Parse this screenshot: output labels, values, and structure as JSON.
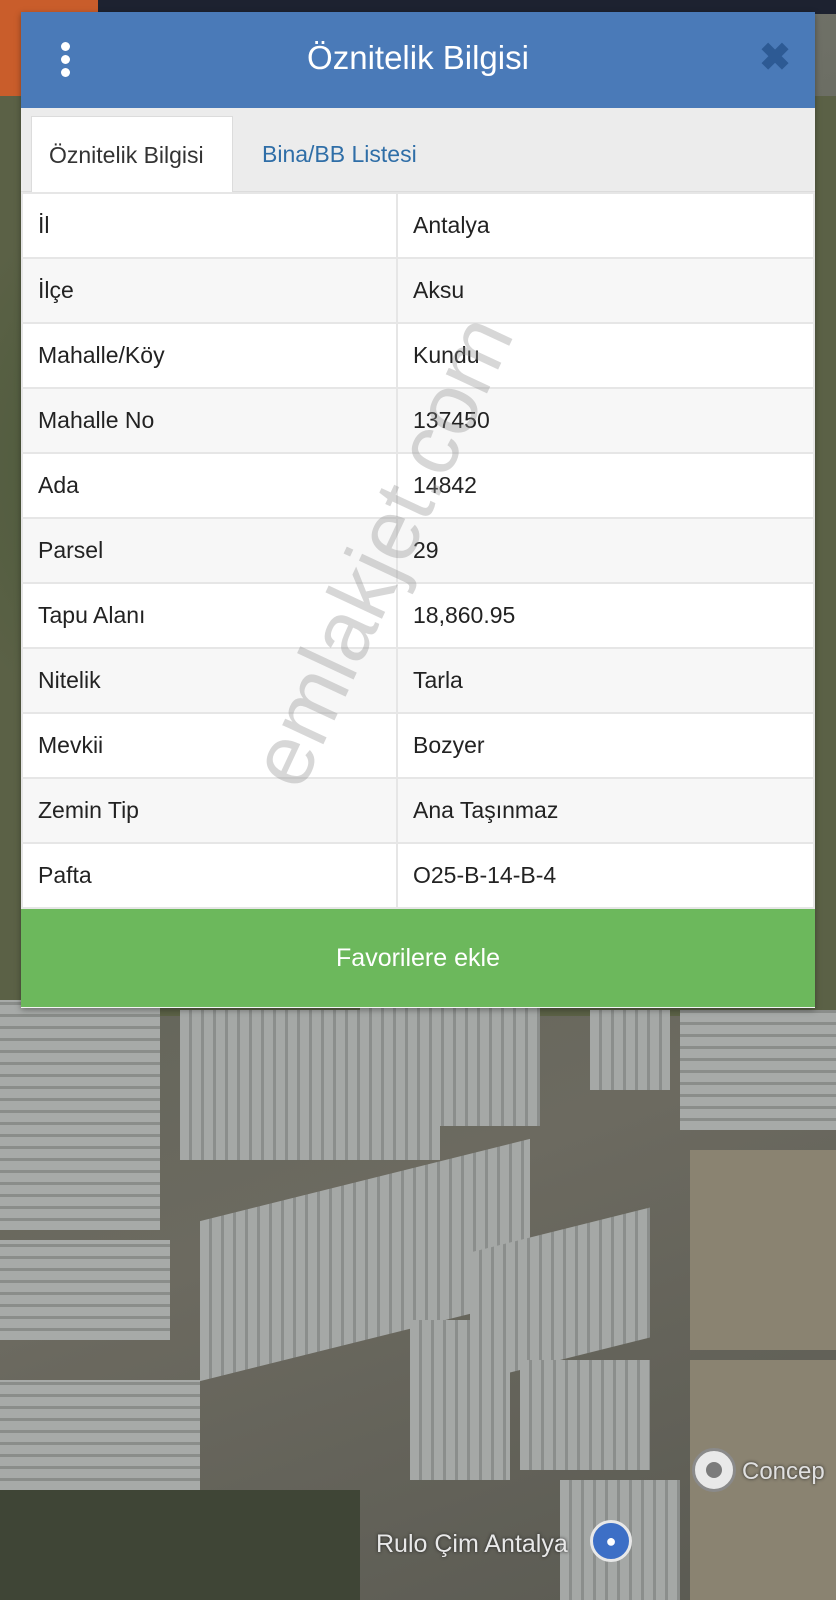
{
  "dialog": {
    "title": "Öznitelik Bilgisi",
    "menu_icon": "vertical-dots-icon",
    "close_icon": "close-icon"
  },
  "tabs": [
    {
      "label": "Öznitelik Bilgisi",
      "active": true
    },
    {
      "label": "Bina/BB Listesi",
      "active": false
    }
  ],
  "attributes": [
    {
      "key": "İl",
      "value": "Antalya"
    },
    {
      "key": "İlçe",
      "value": "Aksu"
    },
    {
      "key": "Mahalle/Köy",
      "value": "Kundu"
    },
    {
      "key": "Mahalle No",
      "value": "137450"
    },
    {
      "key": "Ada",
      "value": "14842"
    },
    {
      "key": "Parsel",
      "value": "29"
    },
    {
      "key": "Tapu Alanı",
      "value": "18,860.95"
    },
    {
      "key": "Nitelik",
      "value": "Tarla"
    },
    {
      "key": "Mevkii",
      "value": "Bozyer"
    },
    {
      "key": "Zemin Tip",
      "value": "Ana Taşınmaz"
    },
    {
      "key": "Pafta",
      "value": "O25-B-14-B-4"
    }
  ],
  "favorite_button": "Favorilere ekle",
  "watermark": "emlakjet.com",
  "map": {
    "labels": [
      "Concep",
      "Rulo Çim Antalya"
    ],
    "pin_icon": "map-pin-icon",
    "lock_icon": "lock-icon"
  },
  "colors": {
    "header": "#4a7ab8",
    "tab_link": "#2f6ea7",
    "favorite_button": "#6cb85c"
  }
}
